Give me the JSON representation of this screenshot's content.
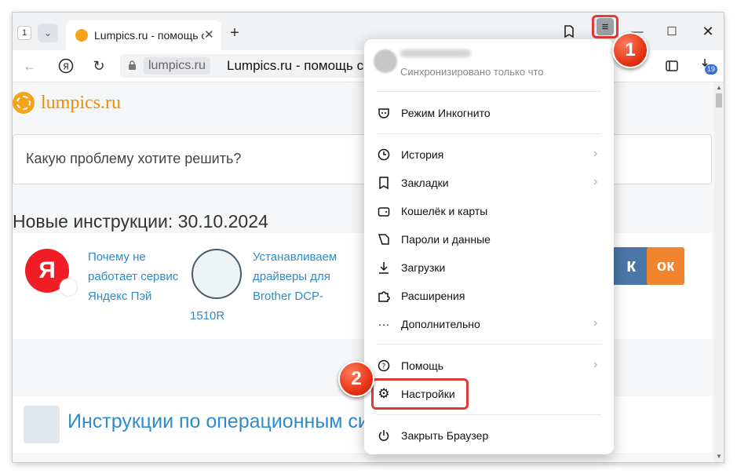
{
  "browser": {
    "tab_count": "1",
    "tab_title": "Lumpics.ru - помощь с к",
    "domain": "lumpics.ru",
    "page_title": "Lumpics.ru - помощь с к",
    "downloads_badge": "19"
  },
  "page": {
    "logo_text": "lumpics.ru",
    "search_placeholder": "Какую проблему хотите решить?",
    "heading": "Новые инструкции: 30.10.2024",
    "card1_lines": [
      "Почему не",
      "работает сервис",
      "Яндекс Пэй"
    ],
    "card2_lines": [
      "Устанавливаем",
      "драйверы для",
      "Brother DCP-",
      "1510R"
    ],
    "yandex_letter": "Я",
    "os_section": "Инструкции по операционным си",
    "vk_letter": "к",
    "ok_letter": "ок"
  },
  "menu": {
    "sync_status": "Синхронизировано только что",
    "items": [
      {
        "label": "Режим Инкогнито"
      },
      {
        "label": "История"
      },
      {
        "label": "Закладки"
      },
      {
        "label": "Кошелёк и карты"
      },
      {
        "label": "Пароли и данные"
      },
      {
        "label": "Загрузки"
      },
      {
        "label": "Расширения"
      },
      {
        "label": "Дополнительно"
      },
      {
        "label": "Помощь"
      },
      {
        "label": "Настройки"
      },
      {
        "label": "Закрыть Браузер"
      }
    ]
  },
  "annotations": {
    "step1": "1",
    "step2": "2"
  },
  "colors": {
    "accent_red": "#e53935",
    "link_blue": "#2d8cc9",
    "logo_orange": "#f08c00"
  }
}
